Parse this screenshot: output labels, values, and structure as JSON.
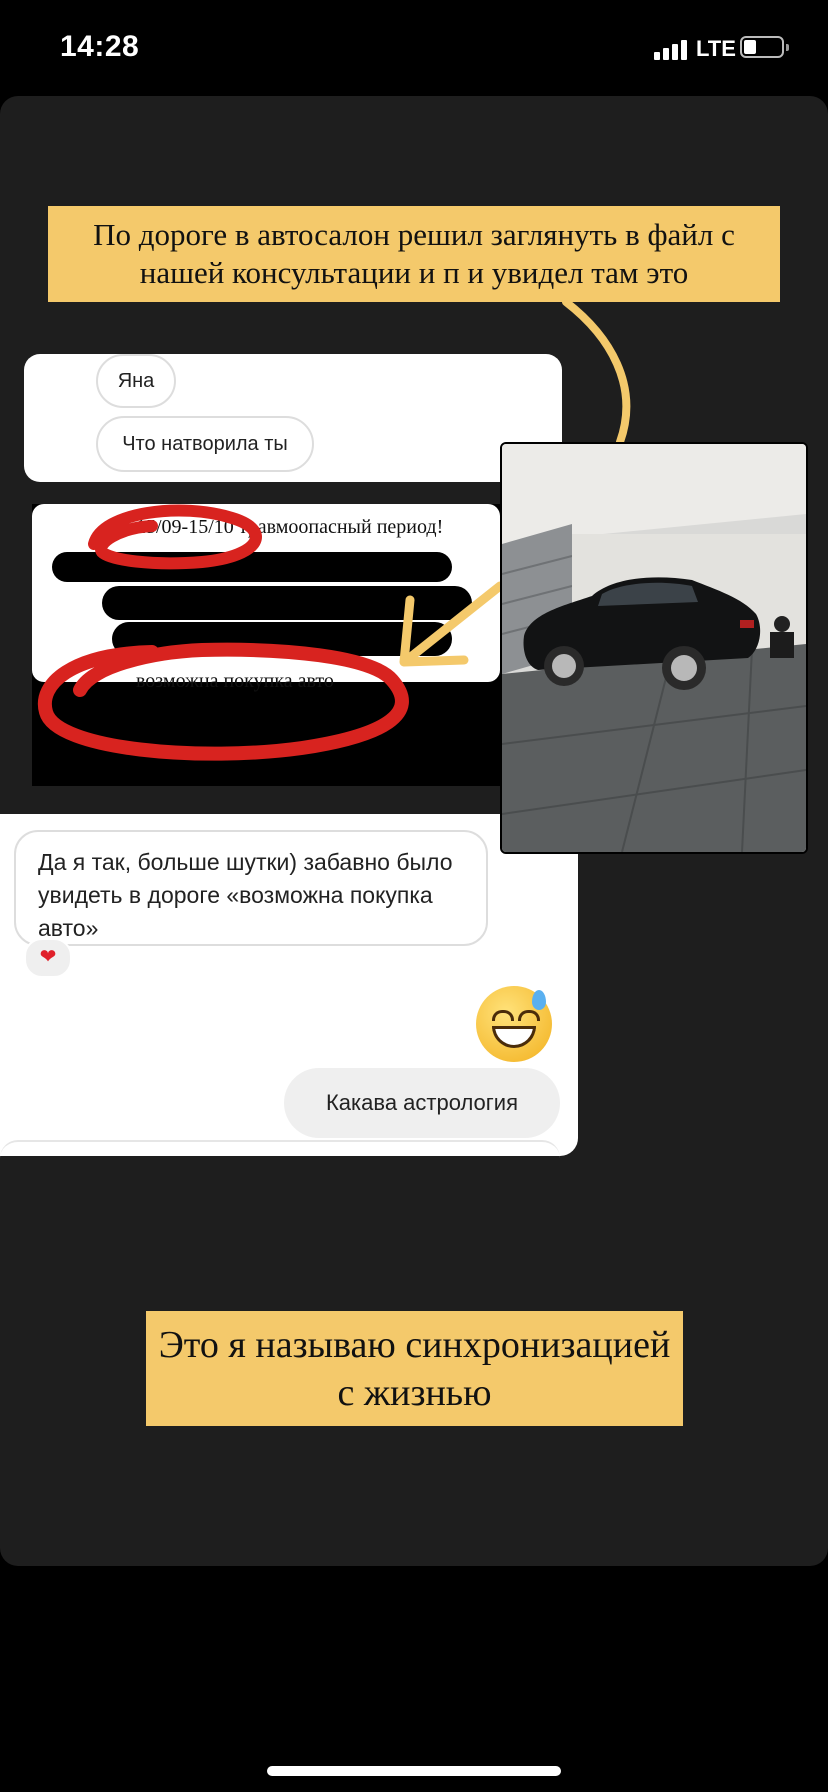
{
  "status_bar": {
    "time": "14:28",
    "network": "LTE",
    "icons": [
      "signal-icon",
      "battery-icon"
    ]
  },
  "captions": {
    "top": "По дороге в автосалон решил заглянуть в файл с нашей консультации и п и увидел там это",
    "bottom": "Это я называю синхронизацией с жизнью"
  },
  "screenshot_top": {
    "pills": [
      "Яна",
      "Что натворила ты"
    ]
  },
  "document": {
    "line1": "15/09-15/10  травмоопасный период!",
    "line2": "возможна покупка авто"
  },
  "chat": {
    "incoming_message": "Да я так, больше шутки) забавно было увидеть в дороге «возможна покупка авто»",
    "reaction": "❤",
    "emoji": "sweat-smile-emoji",
    "outgoing_message": "Какава астрология"
  },
  "photo": {
    "subject": "car-photo"
  },
  "colors": {
    "caption_bg": "#f4c96b",
    "story_bg": "#1e1e1e",
    "scribble_red": "#d8231f",
    "arrow_yellow": "#f4c96b"
  }
}
